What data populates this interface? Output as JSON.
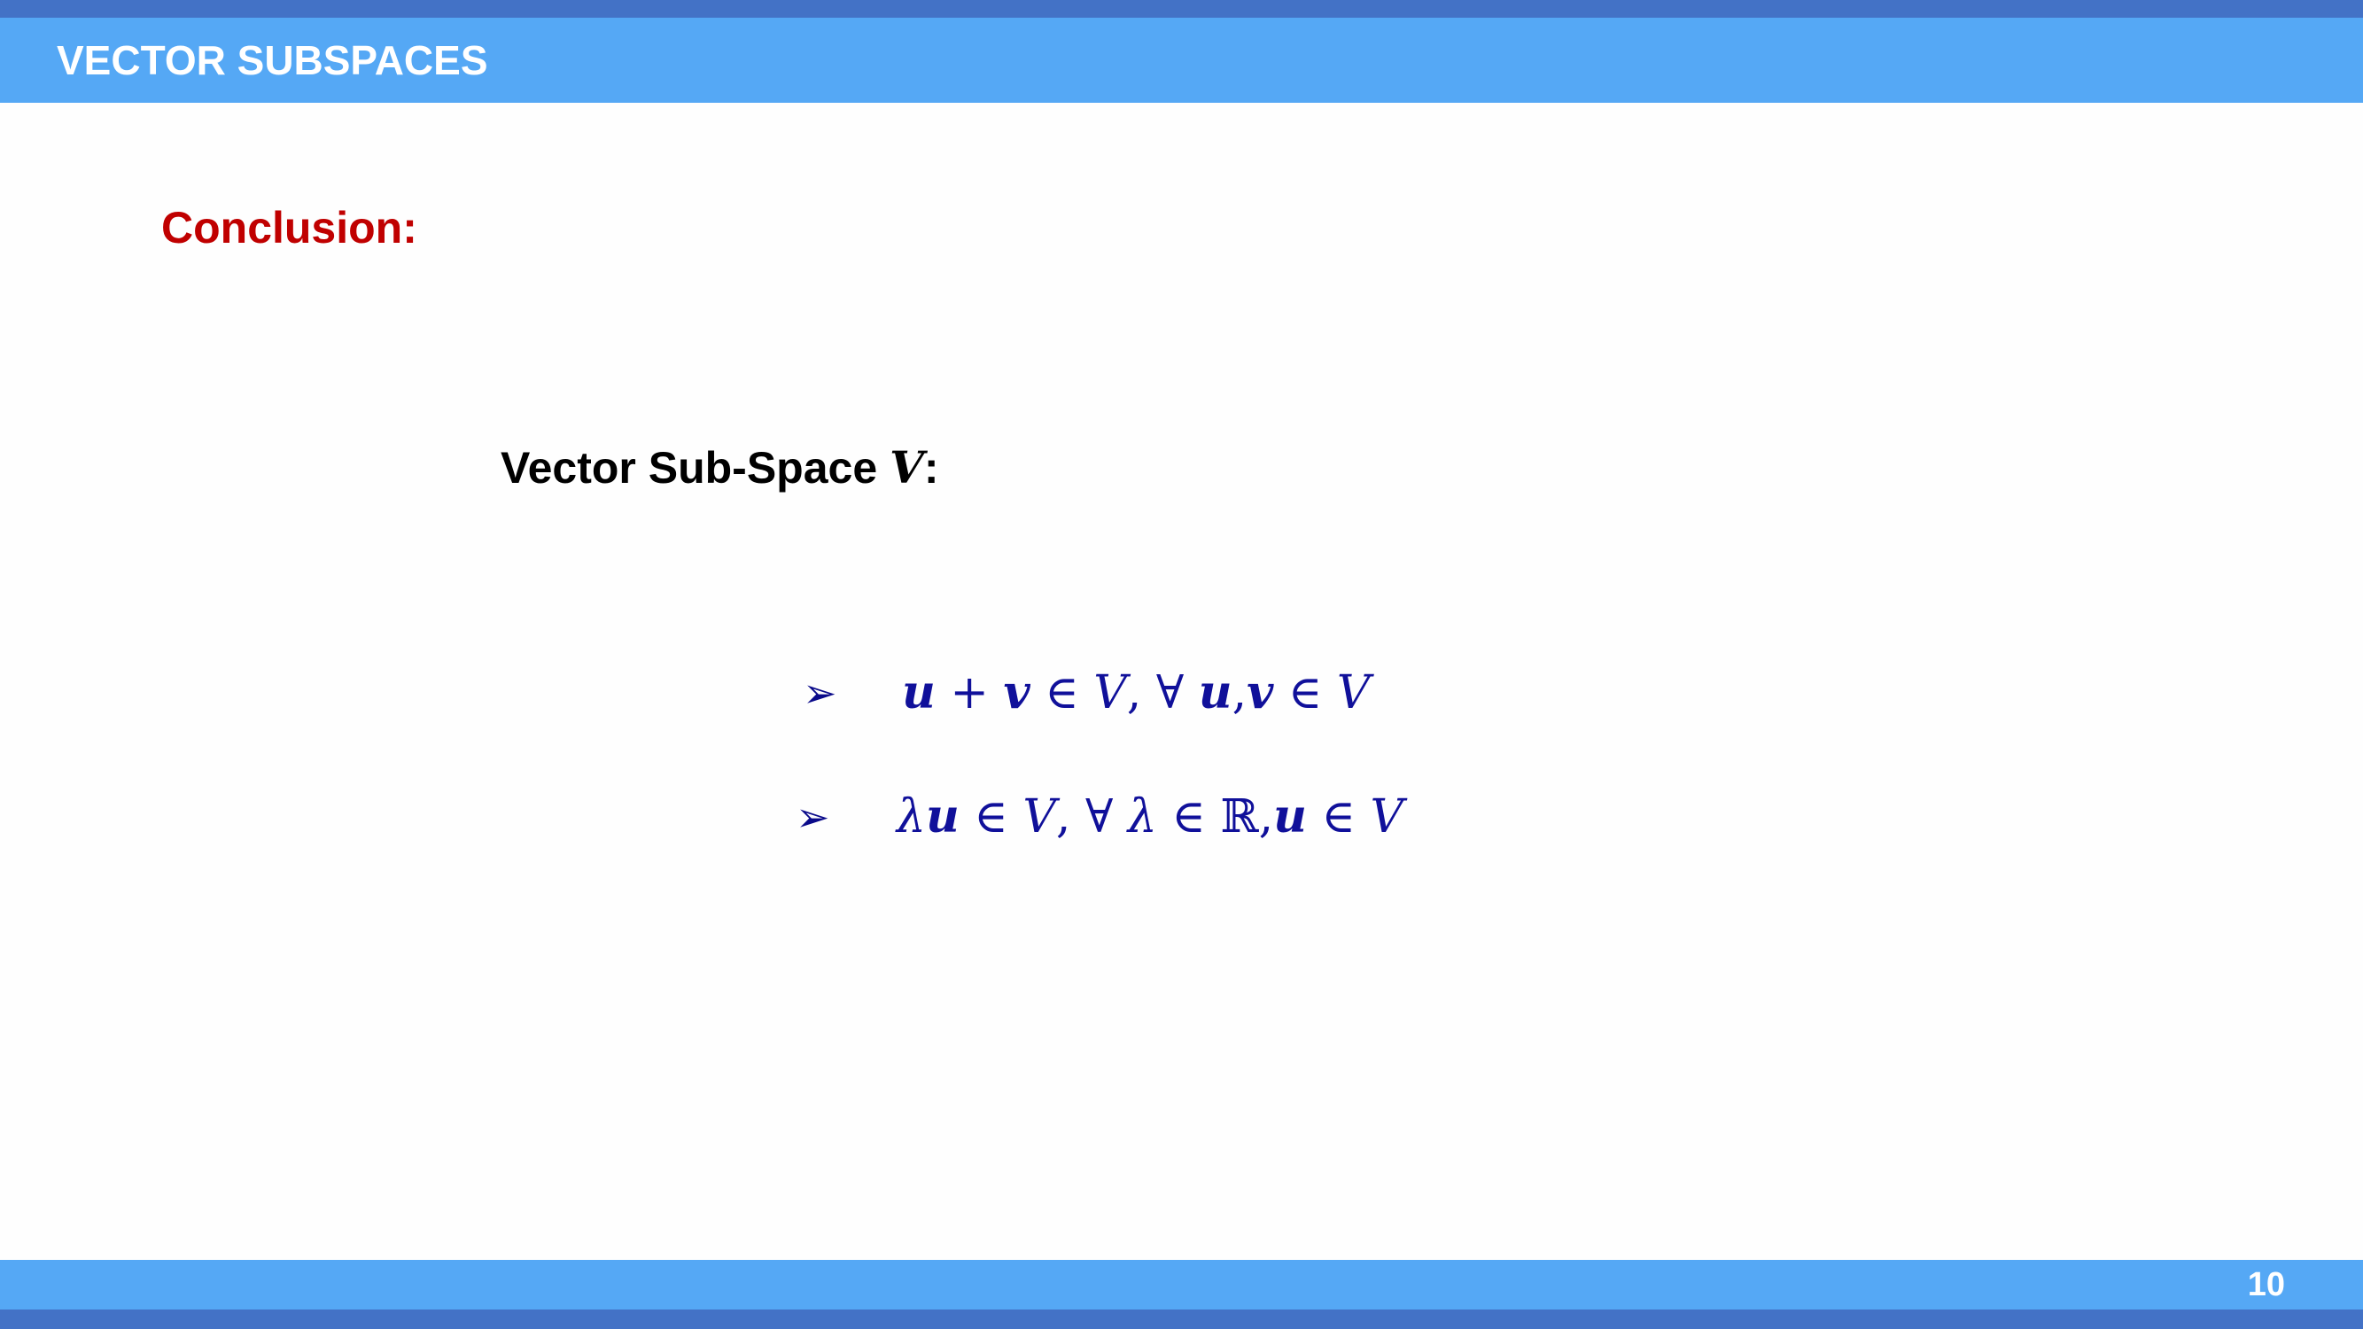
{
  "slide": {
    "title": "VECTOR SUBSPACES",
    "section_heading": "Conclusion:",
    "subheading_prefix": "Vector Sub-Space ",
    "subheading_var": "V",
    "subheading_suffix": ":",
    "page_number": "10"
  },
  "bullets": [
    {
      "icon": "arrow-bullet-icon",
      "symbol": "➢",
      "formula": {
        "u1": "u",
        "plus": " + ",
        "v1": "v",
        "in1": " ∈ ",
        "V1": "V",
        "comma": ",   ∀ ",
        "u2": "u",
        "sep": ",",
        "v2": "v",
        "in2": " ∈ ",
        "V2": "V"
      }
    },
    {
      "icon": "arrow-bullet-icon",
      "symbol": "➢",
      "formula": {
        "lambda1": "λ",
        "u1": "u",
        "in1": " ∈ ",
        "V1": "V",
        "comma": ",  ∀ ",
        "lambda2": "λ",
        "in2": " ∈ ℝ,",
        "u2": "u",
        "in3": " ∈ ",
        "V2": "V"
      }
    }
  ],
  "colors": {
    "title_bar": "#55a8f5",
    "stripe": "#4372c6",
    "heading_red": "#c00000",
    "math_blue": "#10109a"
  }
}
